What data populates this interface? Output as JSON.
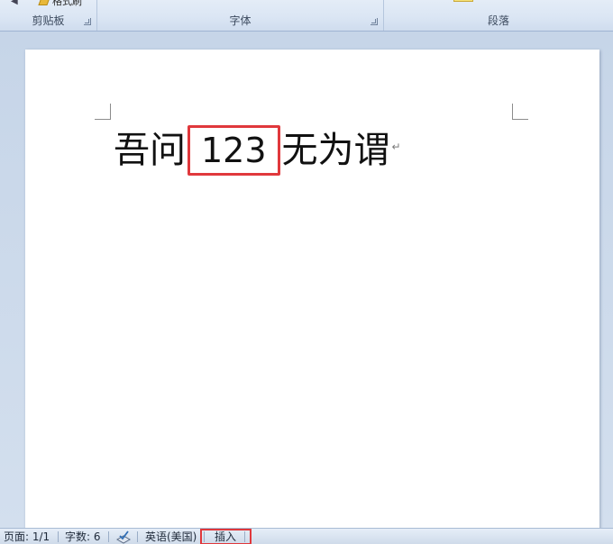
{
  "ribbon": {
    "groups": [
      {
        "label": "剪贴板"
      },
      {
        "label": "字体"
      },
      {
        "label": "段落"
      }
    ],
    "format_painter_label": "格式刷"
  },
  "document": {
    "text_before": "吾问",
    "highlighted_number": "123",
    "text_after": "无为谓",
    "paragraph_mark": "↵"
  },
  "status_bar": {
    "page": "页面: 1/1",
    "word_count": "字数: 6",
    "language": "英语(美国)",
    "mode": "插入"
  },
  "colors": {
    "highlight": "#e0383c"
  }
}
